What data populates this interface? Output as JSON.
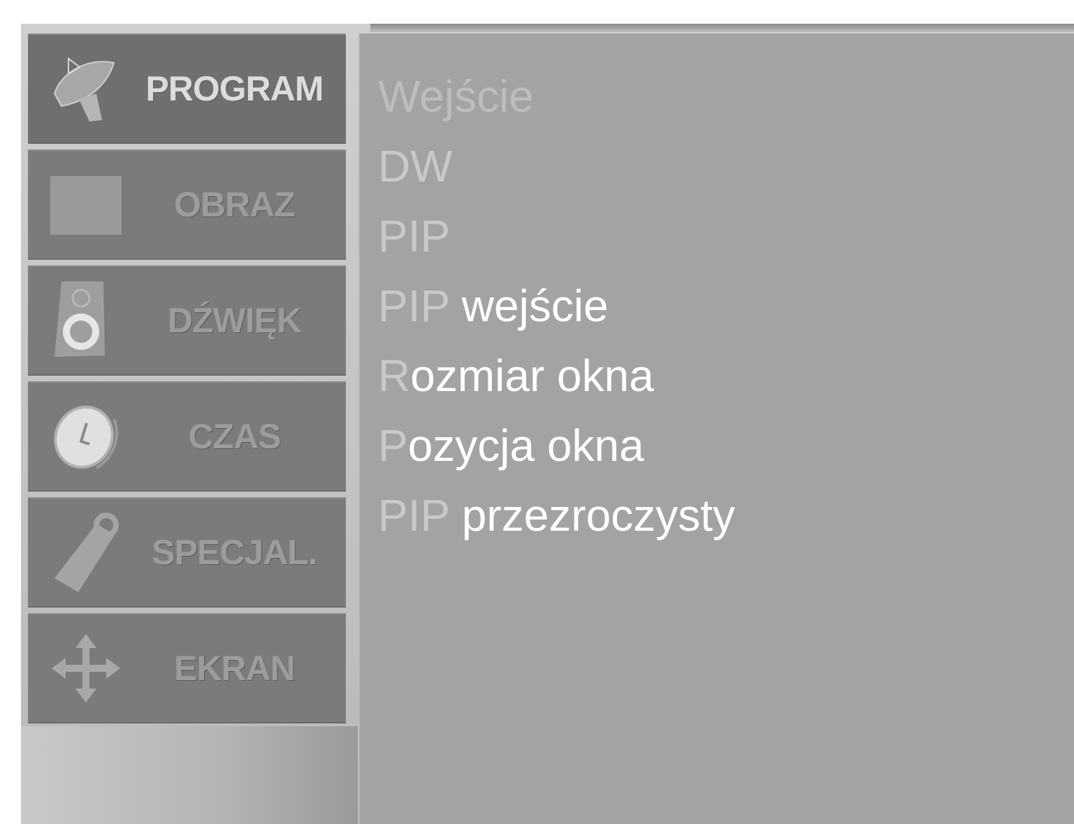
{
  "sidebar": {
    "items": [
      {
        "label": "PROGRAM",
        "icon": "satellite-dish-icon",
        "active": true
      },
      {
        "label": "OBRAZ",
        "icon": "picture-square-icon",
        "active": false
      },
      {
        "label": "DŹWIĘK",
        "icon": "speaker-icon",
        "active": false
      },
      {
        "label": "CZAS",
        "icon": "clock-icon",
        "active": false
      },
      {
        "label": "SPECJAL.",
        "icon": "tag-icon",
        "active": false
      },
      {
        "label": "EKRAN",
        "icon": "move-arrows-icon",
        "active": false
      }
    ]
  },
  "submenu": {
    "items": [
      {
        "head": "Wejście",
        "tail": ""
      },
      {
        "head": "DW",
        "tail": ""
      },
      {
        "head": "PIP",
        "tail": ""
      },
      {
        "head": "PIP",
        "tail": "wejście"
      },
      {
        "head": "R",
        "tail": "ozmiar okna"
      },
      {
        "head": "P",
        "tail": "ozycja okna"
      },
      {
        "head": "PIP",
        "tail": "przezroczysty"
      }
    ]
  },
  "colors": {
    "menu_bg": "#7b7b7b",
    "panel_bg": "#a3a3a3",
    "active_label": "#dcdcdc",
    "inactive_label": "#9c9c9c",
    "highlight_text": "#ffffff"
  }
}
